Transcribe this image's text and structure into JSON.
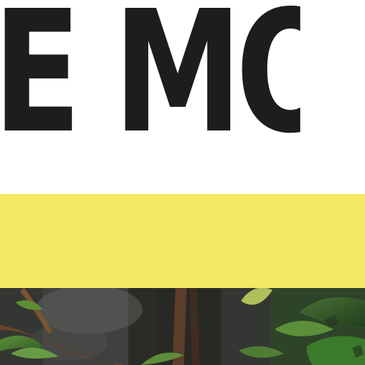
{
  "header": {
    "headline": "E MOD"
  },
  "colors": {
    "headline_text": "#1d1d1d",
    "band": "#f4e864",
    "background": "#ffffff"
  },
  "image": {
    "icon": "forest-photo"
  }
}
